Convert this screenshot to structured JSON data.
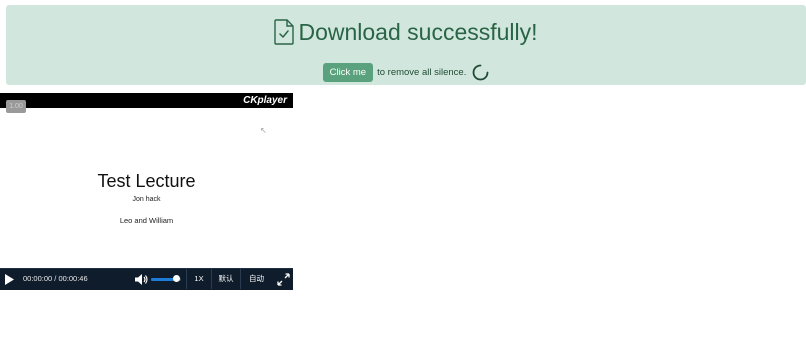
{
  "banner": {
    "title": "Download successfully!",
    "title_icon": "file-check-icon",
    "button_label": "Click me",
    "action_text": "to remove all silence.",
    "loading_icon": "spinner-icon",
    "background": "#d1e7dd",
    "text_color": "#2a6446",
    "button_color": "#5aa17d"
  },
  "player": {
    "brand": "CKplayer",
    "speed_badge": "1.00",
    "video": {
      "slide_title": "Test Lecture",
      "slide_subtitle": "Jon hack",
      "slide_authors": "Leo and William"
    },
    "controls": {
      "play_icon": "play-icon",
      "time": "00:00:00 / 00:00:46",
      "volume_icon": "volume-icon",
      "volume_level": 0.85,
      "speed_label": "1X",
      "default_label": "默认",
      "auto_label": "自动",
      "fullscreen_icon": "fullscreen-icon",
      "bar_color": "#0f1c2b",
      "accent": "#1f7bd8"
    }
  }
}
